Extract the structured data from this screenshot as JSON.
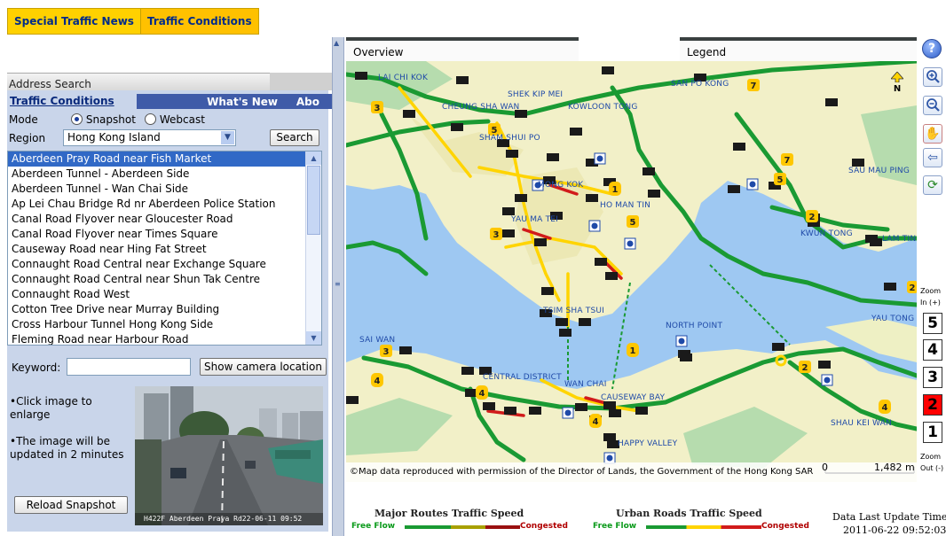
{
  "top_tabs": [
    "Special Traffic News",
    "Traffic Conditions"
  ],
  "left": {
    "address_search_tab": "Address Search",
    "traffic_conditions_title": "Traffic Conditions",
    "whats_new": "What's New",
    "about_truncated": "Abo",
    "mode_label": "Mode",
    "mode_options": [
      "Snapshot",
      "Webcast"
    ],
    "mode_selected": "Snapshot",
    "region_label": "Region",
    "region_value": "Hong Kong Island",
    "search_button": "Search",
    "locations": [
      "Aberdeen Pray Road near Fish Market",
      "Aberdeen Tunnel - Aberdeen Side",
      "Aberdeen Tunnel - Wan Chai Side",
      "Ap Lei Chau Bridge Rd nr Aberdeen Police Station",
      "Canal Road Flyover near Gloucester Road",
      "Canal Road Flyover near Times Square",
      "Causeway Road near Hing Fat Street",
      "Connaught Road Central near Exchange Square",
      "Connaught Road Central near Shun Tak Centre",
      "Connaught Road West",
      "Cotton Tree Drive near Murray Building",
      "Cross Harbour Tunnel Hong Kong Side",
      "Fleming Road near Harbour Road"
    ],
    "selected_location": "Aberdeen Pray Road near Fish Market",
    "keyword_label": "Keyword:",
    "keyword_value": "",
    "show_camera_button": "Show camera location",
    "note_click": "Click image to enlarge",
    "note_update": "The image will be updated in 2 minutes",
    "reload_button": "Reload Snapshot",
    "camera_caption": "H422F Aberdeen Praya Rd22-06-11 09:52"
  },
  "map": {
    "overview_tab": "Overview",
    "legend_tab": "Legend",
    "north_label": "N",
    "places": [
      "LAI CHI KOK",
      "SHEK KIP MEI",
      "CHEUNG SHA WAN",
      "KOWLOON TONG",
      "SAN PO KONG",
      "SHAM SHUI PO",
      "MONG KOK",
      "HO MAN TIN",
      "YAU MA TEI",
      "SAU MAU PING",
      "KWUN TONG",
      "LAM TIN",
      "TSIM SHA TSUI",
      "YAU TONG",
      "NORTH POINT",
      "SAI WAN",
      "CENTRAL DISTRICT",
      "WAN CHAI",
      "CAUSEWAY BAY",
      "HAPPY VALLEY",
      "SHAU KEI WAN"
    ],
    "copyright": "©Map data reproduced with permission of the Director of Lands, the Government of the Hong Kong SAR",
    "scale_start": "0",
    "scale_end": "1,482 m"
  },
  "toolbar": {
    "icons": [
      "help-icon",
      "zoom-in-icon",
      "zoom-out-icon",
      "pan-hand-icon",
      "back-arrow-icon",
      "refresh-icon"
    ],
    "zoom_in_label": "Zoom In (+)",
    "zoom_levels": [
      "5",
      "4",
      "3",
      "2",
      "1"
    ],
    "zoom_active": "2",
    "zoom_out_label": "Zoom Out (-)"
  },
  "legend": {
    "major_title": "Major Routes Traffic Speed",
    "urban_title": "Urban Roads Traffic Speed",
    "free_flow": "Free Flow",
    "congested": "Congested",
    "update_label": "Data Last Update Time",
    "update_time": "2011-06-22 09:52:03"
  },
  "colors": {
    "free_flow": "#1a9a33",
    "slow": "#ffd400",
    "congested": "#d11b1b",
    "water": "#9ec8f2",
    "land": "#f2f0c8",
    "accent_tab": "#ffd100"
  }
}
